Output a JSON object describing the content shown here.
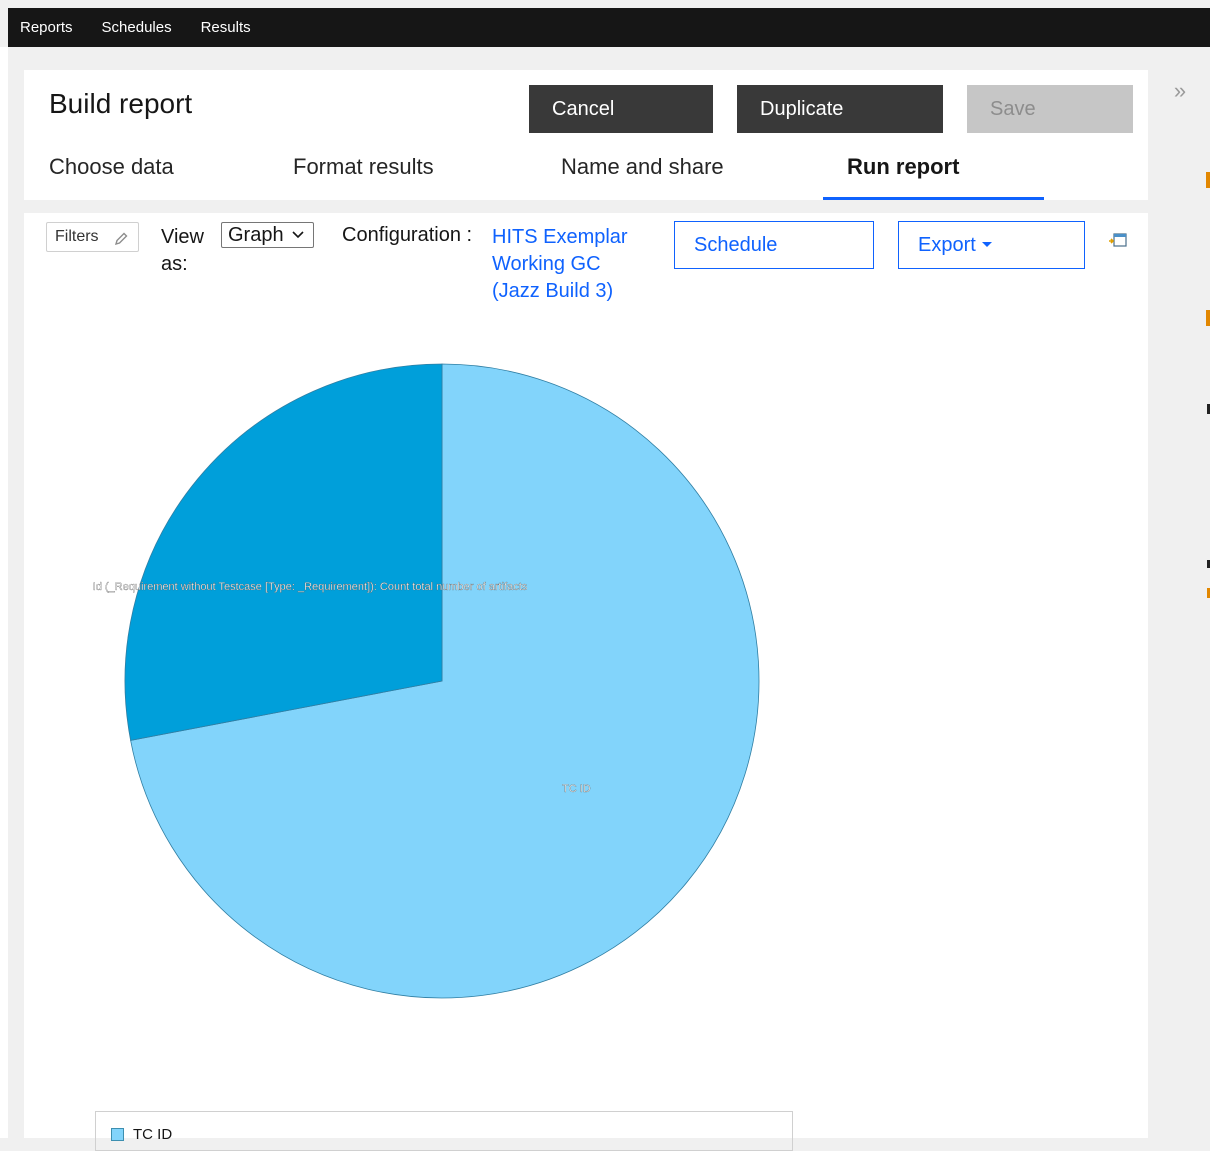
{
  "topnav": {
    "items": [
      {
        "label": "Reports"
      },
      {
        "label": "Schedules"
      },
      {
        "label": "Results"
      }
    ]
  },
  "header": {
    "title": "Build report",
    "cancel_label": "Cancel",
    "duplicate_label": "Duplicate",
    "save_label": "Save",
    "tabs": [
      {
        "label": "Choose data"
      },
      {
        "label": "Format results"
      },
      {
        "label": "Name and share"
      },
      {
        "label": "Run report",
        "active": true
      }
    ]
  },
  "toolbar": {
    "filters_label": "Filters",
    "view_label": "View as:",
    "view_selected": "Graph",
    "configuration_label": "Configuration :",
    "configuration_value": "HITS Exemplar Working GC (Jazz Build 3)",
    "schedule_label": "Schedule",
    "export_label": "Export"
  },
  "icons": {
    "pencil": "pencil-icon",
    "chevron": "chevron-down-icon",
    "caret": "caret-down-icon",
    "expand": "expand-panel-icon",
    "collapse": "double-chevron-right-icon"
  },
  "colors": {
    "accent": "#0f62fe",
    "primary_button": "#393939",
    "disabled_button": "#c6c6c6",
    "topbar": "#161616"
  },
  "chart_data": {
    "type": "pie",
    "slices": [
      {
        "label": "TC ID",
        "value": 72,
        "color": "#82d4fb"
      },
      {
        "label": "Id (_Requirement without Testcase [Type: _Requirement]): Count total number of artifacts",
        "value": 28,
        "color": "#009fda"
      }
    ],
    "legend": [
      {
        "label": "TC ID",
        "color": "#82d4fb"
      }
    ],
    "legend_placement": "bottom"
  }
}
